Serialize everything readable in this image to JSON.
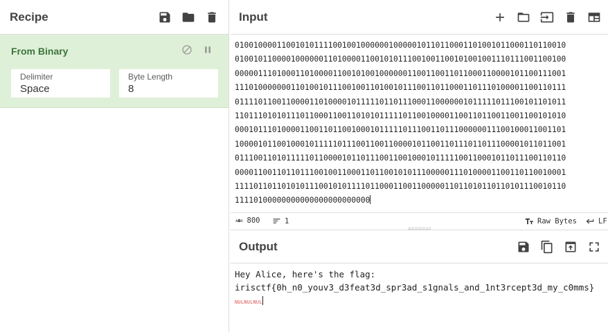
{
  "recipe": {
    "title": "Recipe",
    "operation": {
      "name": "From Binary",
      "delimiter_label": "Delimiter",
      "delimiter_value": "Space",
      "byte_length_label": "Byte Length",
      "byte_length_value": "8"
    }
  },
  "input": {
    "title": "Input",
    "lines": [
      "01001000011001010111100100100000010000010110110001101001011000110110010",
      "01001011000010000001101000011001010111001001100101001001110111001100100",
      "00000111010001101000011001010010000001100110011011000110000101100111001",
      "11101000000011010010111001001101001011100110110001101110100001100110111",
      "01111011001100001101000010111110110111000110000001011111011100101101011",
      "11011101010111011000110011010101111101100100001100110110011001100101010",
      "00010111010000110011011001000101111101110011011100000011100100011001101",
      "10000101100100010111110111001100110000101100110111011011100001011011001",
      "01110011010111110110000101101110011001000101111100110001011011100110110",
      "00001100110110111001001100011011001010111000001110100001100110110010001",
      "11110110110101011100101011110110001100110000011011010110110101110010110",
      "11110100000000000000000000000"
    ],
    "status": {
      "length_icon": "abc-icon",
      "length": "800",
      "lines_icon": "lines-icon",
      "lines": "1",
      "raw_bytes_icon": "text-size-icon",
      "raw_bytes": "Raw Bytes",
      "eol": "LF"
    }
  },
  "output": {
    "title": "Output",
    "line1": "Hey Alice, here's the flag:",
    "line2": "irisctf{0h_n0_youv3_d3feat3d_spr3ad_s1gnals_and_1nt3rcept3d_my_c0mms}",
    "nul_markers": "NULNULNUL"
  }
}
